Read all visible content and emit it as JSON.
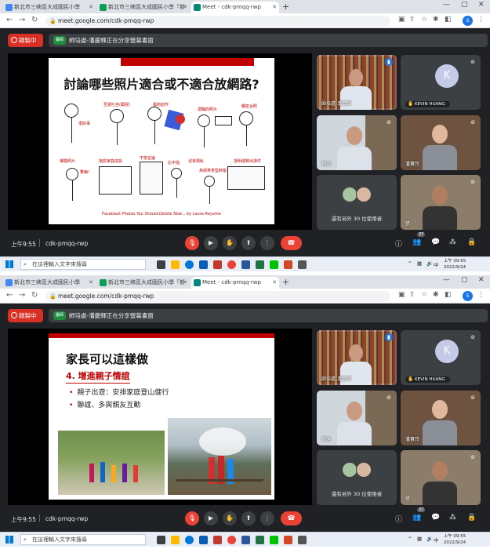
{
  "browser": {
    "tabs": [
      {
        "label": "新北市三峽區大成國民小學",
        "favicon_color": "#4285f4"
      },
      {
        "label": "新北市三峽區大成國民小學「新",
        "favicon_color": "#0f9d58"
      },
      {
        "label": "Meet - cdk-pmqq-rwp",
        "favicon_color": "#00897b"
      }
    ],
    "url": "meet.google.com/cdk-pmqq-rwp"
  },
  "meet": {
    "recording_label": "錄製中",
    "presenting_banner": "師培處-潘慶輝正在分享螢幕畫面",
    "presenter_avatar_text": "臺師",
    "time": "上午9:55",
    "meeting_code": "cdk-pmqq-rwp",
    "participant_count_badge": "37",
    "others_label": "還有另外 30 位使用者",
    "participants": [
      {
        "name": "師培處-潘慶輝",
        "tile": "speaking"
      },
      {
        "name": "KEVIN HUANG",
        "initial": "K"
      },
      {
        "name": "賴滄"
      },
      {
        "name": "潘寶玲"
      },
      {
        "name": "張"
      }
    ],
    "accent": "#8ab4f8",
    "record_color": "#d93025",
    "hangup_color": "#ea4335"
  },
  "slides": [
    {
      "title": "討論哪些照片適合或不適合放網路?",
      "labels": [
        "吾愛吐舌(跟屁)",
        "藝術創作",
        "濃糊的照片",
        "親密合照",
        "很好事",
        "裸露照片",
        "抱怨家庭成員",
        "不當言論",
        "驚嚇!",
        "比中指",
        "沒有隱私",
        "為搞笑拿堅醉客",
        "證明或釋出證件"
      ],
      "credit": "Facebook Photos You Should Delete Now... by Laura Reyome"
    },
    {
      "title": "家長可以這樣做",
      "subtitle": "4. 增進親子情誼",
      "bullets": [
        "親子出遊：安排家庭登山健行",
        "聯誼、多與親友互動"
      ]
    }
  ],
  "taskbar": {
    "search_placeholder": "在這裡輸入文字來搜尋",
    "ime": "中",
    "time": "上午 09:55",
    "date_a": "2022/9/24",
    "date_b": "2022/9/24"
  }
}
